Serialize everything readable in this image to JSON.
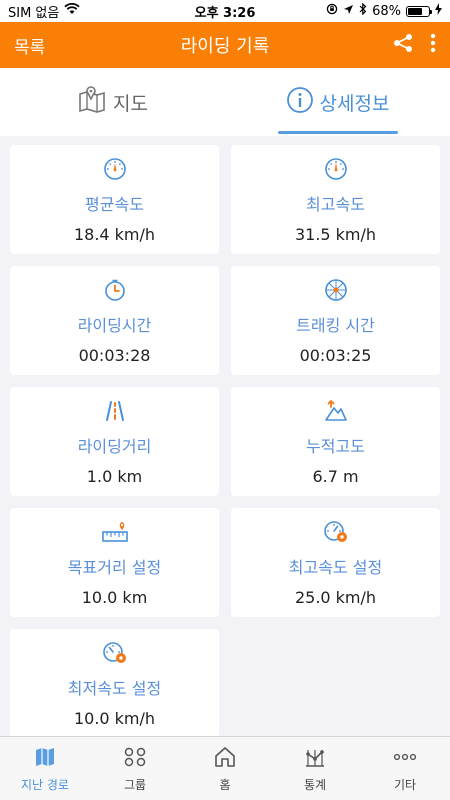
{
  "status": {
    "carrier": "SIM 없음",
    "time": "오후 3:26",
    "battery": "68%"
  },
  "navbar": {
    "back_label": "목록",
    "title": "라이딩 기록"
  },
  "tabs": [
    {
      "label": "지도"
    },
    {
      "label": "상세정보"
    }
  ],
  "cards": [
    {
      "label": "평균속도",
      "value": "18.4 km/h"
    },
    {
      "label": "최고속도",
      "value": "31.5 km/h"
    },
    {
      "label": "라이딩시간",
      "value": "00:03:28"
    },
    {
      "label": "트래킹 시간",
      "value": "00:03:25"
    },
    {
      "label": "라이딩거리",
      "value": "1.0 km"
    },
    {
      "label": "누적고도",
      "value": "6.7 m"
    },
    {
      "label": "목표거리 설정",
      "value": "10.0 km"
    },
    {
      "label": "최고속도 설정",
      "value": "25.0 km/h"
    },
    {
      "label": "최저속도 설정",
      "value": "10.0 km/h"
    }
  ],
  "bottom_nav": [
    {
      "label": "지난 경로"
    },
    {
      "label": "그룹"
    },
    {
      "label": "홈"
    },
    {
      "label": "통계"
    },
    {
      "label": "기타"
    }
  ],
  "colors": {
    "accent": "#fa7f06",
    "link": "#5b8fd8",
    "active": "#4a90d9"
  }
}
